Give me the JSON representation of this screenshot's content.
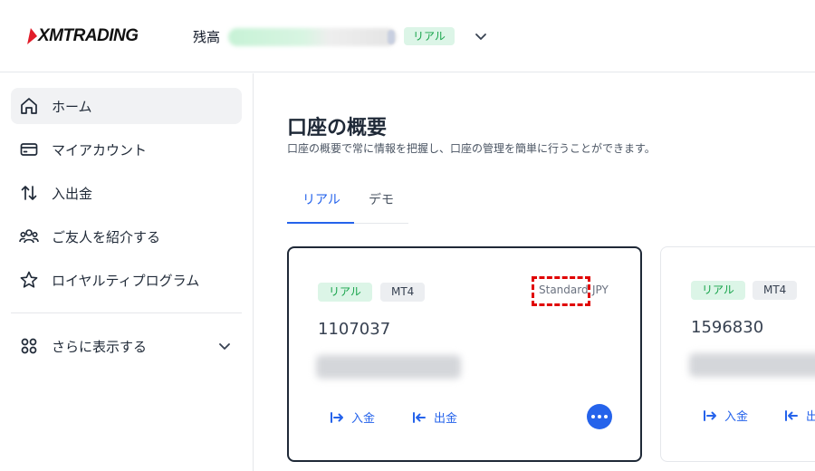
{
  "header": {
    "logo_text": "XMTRADING",
    "balance_label": "残高",
    "account_tag": "リアル"
  },
  "sidebar": {
    "items": [
      {
        "label": "ホーム",
        "icon": "home-icon"
      },
      {
        "label": "マイアカウント",
        "icon": "card-icon"
      },
      {
        "label": "入出金",
        "icon": "transfer-arrows-icon"
      },
      {
        "label": "ご友人を紹介する",
        "icon": "people-icon"
      },
      {
        "label": "ロイヤルティプログラム",
        "icon": "star-icon"
      }
    ],
    "more": {
      "label": "さらに表示する",
      "icon": "grid-icon"
    }
  },
  "main": {
    "title": "口座の概要",
    "subtitle": "口座の概要で常に情報を把握し、口座の管理を簡単に行うことができます。",
    "tabs": [
      {
        "label": "リアル",
        "active": true
      },
      {
        "label": "デモ",
        "active": false
      }
    ],
    "accounts": [
      {
        "tag": "リアル",
        "platform": "MT4",
        "type": "Standard",
        "currency": "JPY",
        "number": "1107037",
        "deposit": "入金",
        "withdraw": "出金"
      },
      {
        "tag": "リアル",
        "platform": "MT4",
        "number": "1596830",
        "deposit": "入金",
        "withdraw": "出金"
      }
    ]
  },
  "colors": {
    "accent": "#2563eb",
    "real_tag_bg": "#dcf5e7",
    "real_tag_text": "#16a34a",
    "highlight": "#e00000"
  }
}
